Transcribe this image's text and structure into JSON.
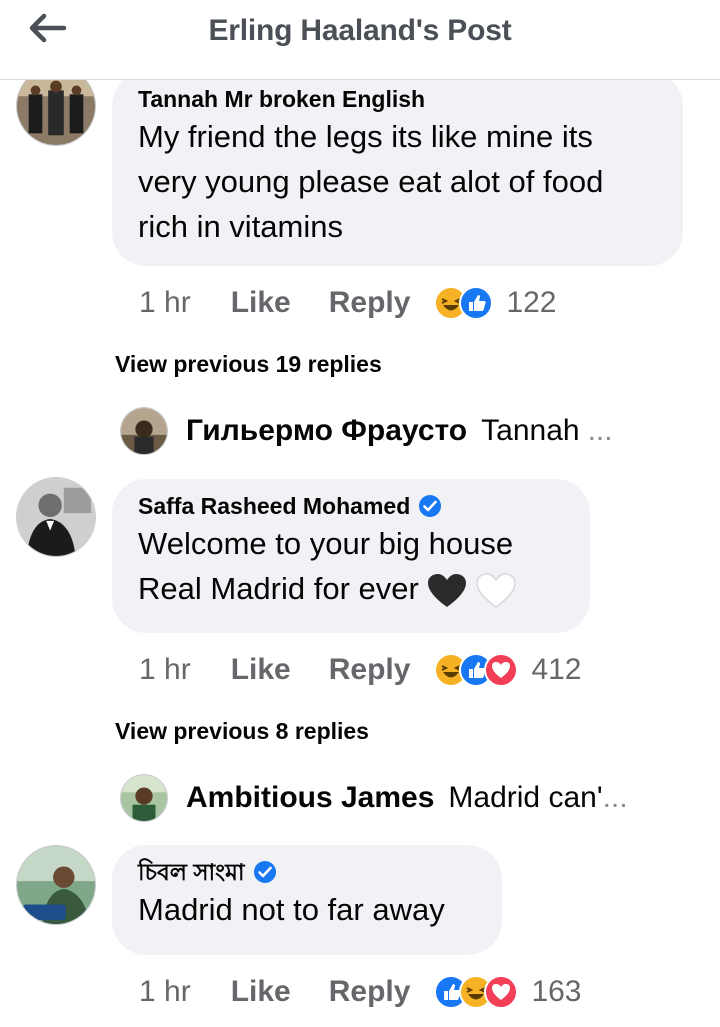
{
  "header": {
    "title": "Erling Haaland's Post"
  },
  "comments": [
    {
      "author": "Tannah Mr broken English",
      "lines": [
        "My friend the legs  its  like mine its",
        "very young please eat alot of food",
        "rich in vitamins"
      ],
      "time": "1 hr",
      "like": "Like",
      "reply": "Reply",
      "count": "122",
      "reactions": [
        "haha",
        "like"
      ]
    },
    {
      "author": "Saffa Rasheed Mohamed",
      "verified": true,
      "lines": [
        "Welcome to your  big house",
        "Real Madrid for ever"
      ],
      "time": "1 hr",
      "like": "Like",
      "reply": "Reply",
      "count": "412",
      "reactions": [
        "haha",
        "like",
        "love"
      ]
    },
    {
      "author": "চিবল সাংমা",
      "verified": true,
      "lines": [
        "Madrid not to far away"
      ],
      "time": "1 hr",
      "like": "Like",
      "reply": "Reply",
      "count": "163",
      "reactions": [
        "like",
        "haha",
        "love"
      ]
    }
  ],
  "view_previous": [
    "View previous 19 replies",
    "View previous 8 replies"
  ],
  "reply_previews": [
    {
      "name": "Гильермо Фраусто",
      "snippet": "Tannah",
      "ellipsis": "..."
    },
    {
      "name": "Ambitious James",
      "snippet": "Madrid can'",
      "ellipsis": "..."
    }
  ],
  "colors": {
    "bubble": "#f0f2f5",
    "meta": "#65676b",
    "verified": "#1877f2",
    "haha": "#f7b125",
    "like": "#1877f2",
    "love": "#f33e58"
  }
}
